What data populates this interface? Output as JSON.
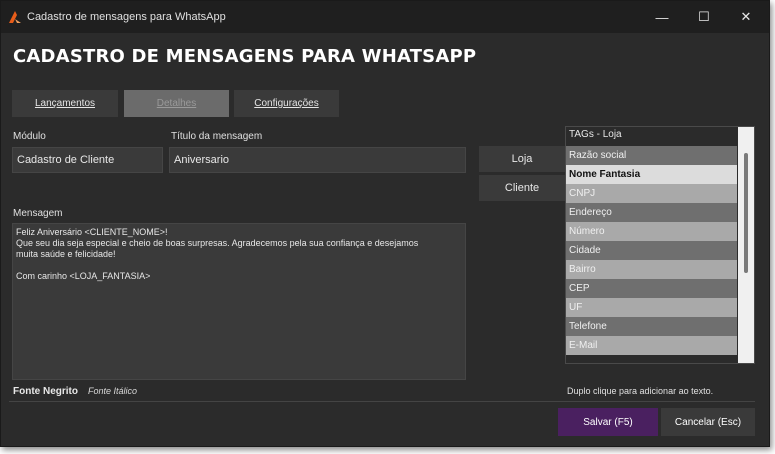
{
  "window": {
    "title": "Cadastro de mensagens para WhatsApp",
    "minimize": "—",
    "maximize": "☐",
    "close": "✕"
  },
  "header": {
    "title": "CADASTRO DE MENSAGENS PARA WHATSAPP"
  },
  "tabs": [
    {
      "label": "Lançamentos"
    },
    {
      "label": "Detalhes"
    },
    {
      "label": "Configurações"
    }
  ],
  "form": {
    "modulo_label": "Módulo",
    "modulo_value": "Cadastro de Cliente",
    "titulo_label": "Título da mensagem",
    "titulo_value": "Aniversario",
    "mensagem_label": "Mensagem",
    "mensagem_lines": [
      "Feliz Aniversário <CLIENTE_NOME>!",
      "Que seu dia seja especial e cheio de boas surpresas. Agradecemos pela sua confiança e desejamos",
      "muita saúde e felicidade!",
      "",
      "Com carinho <LOJA_FANTASIA>"
    ]
  },
  "side_buttons": {
    "loja": "Loja",
    "cliente": "Cliente"
  },
  "tags": {
    "header": "TAGs - Loja",
    "items": [
      "Razão social",
      "Nome Fantasia",
      "CNPJ",
      "Endereço",
      "Número",
      "Cidade",
      "Bairro",
      "CEP",
      "UF",
      "Telefone",
      "E-Mail"
    ],
    "selected_index": 1,
    "hint": "Duplo clique para adicionar ao texto."
  },
  "font_options": {
    "bold": "Fonte Negrito",
    "italic": "Fonte Itálico"
  },
  "actions": {
    "save": "Salvar (F5)",
    "cancel": "Cancelar (Esc)"
  },
  "colors": {
    "primary_button": "#4a2060",
    "background": "#2b2b2b",
    "app_icon": "#e85d1a"
  }
}
